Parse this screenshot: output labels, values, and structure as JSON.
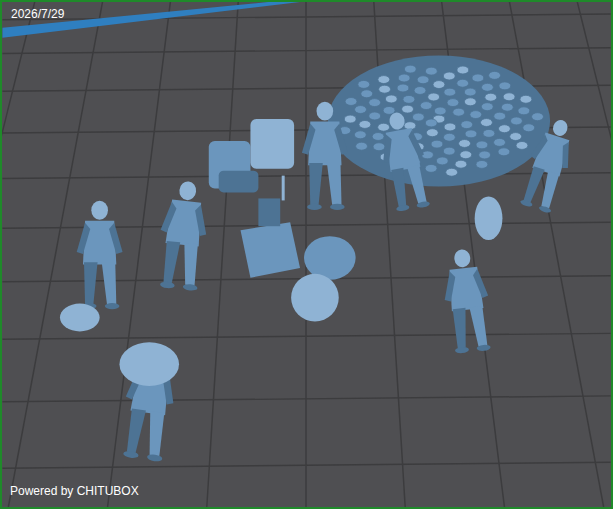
{
  "viewport": {
    "date": "2026/7/29",
    "watermark": "Powered by CHITUBOX"
  }
}
